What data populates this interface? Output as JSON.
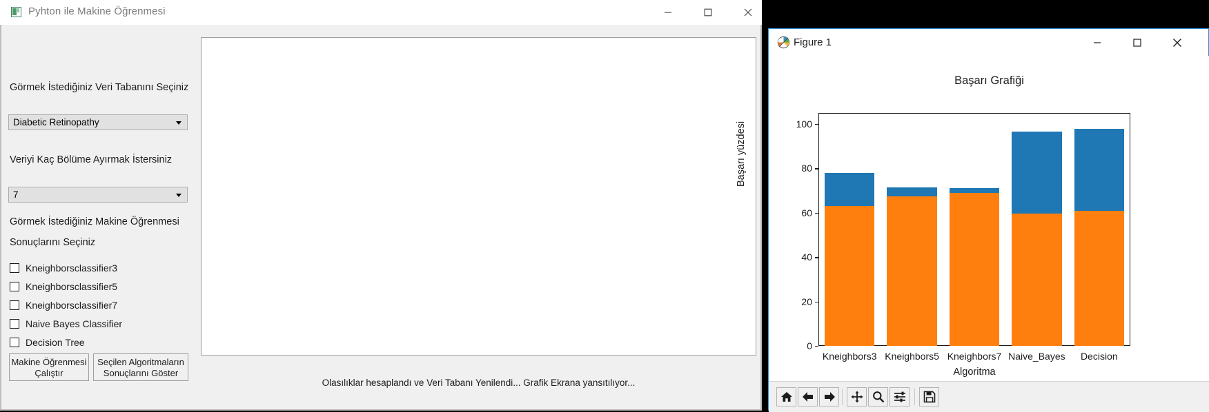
{
  "main_window": {
    "title": "Pyhton ile Makine Öğrenmesi",
    "icon": "app-icon",
    "controls": {
      "minimize": "minimize-icon",
      "maximize": "maximize-icon",
      "close": "close-icon"
    },
    "labels": {
      "database": "Görmek İstediğiniz Veri Tabanını Seçiniz",
      "split": "Veriyi Kaç Bölüme Ayırmak İstersiniz",
      "algorithms_line1": "Görmek İstediğiniz Makine Öğrenmesi",
      "algorithms_line2": "Sonuçlarını Seçiniz"
    },
    "database_select": {
      "value": "Diabetic Retinopathy",
      "arrow": "chevron-down-icon"
    },
    "split_select": {
      "value": "7",
      "arrow": "chevron-down-icon"
    },
    "checkboxes": [
      {
        "label": "Kneighborsclassifier3",
        "checked": false
      },
      {
        "label": "Kneighborsclassifier5",
        "checked": false
      },
      {
        "label": "Kneighborsclassifier7",
        "checked": false
      },
      {
        "label": "Naive Bayes Classifier",
        "checked": false
      },
      {
        "label": "Decision Tree",
        "checked": false
      }
    ],
    "buttons": {
      "run_line1": "Makine Öğrenmesi",
      "run_line2": "Çalıştır",
      "show_line1": "Seçilen Algoritmaların",
      "show_line2": "Sonuçlarını Göster"
    },
    "status": "Olasılıklar hesaplandı ve Veri Tabanı Yenilendi... Grafik Ekrana yansıtılıyor..."
  },
  "figure_window": {
    "title": "Figure 1",
    "icon": "matplotlib-icon",
    "controls": {
      "minimize": "minimize-icon",
      "maximize": "maximize-icon",
      "close": "close-icon"
    },
    "toolbar": [
      {
        "name": "home-icon",
        "tooltip": "Home"
      },
      {
        "name": "back-arrow-icon",
        "tooltip": "Back"
      },
      {
        "name": "forward-arrow-icon",
        "tooltip": "Forward"
      },
      {
        "name": "pan-move-icon",
        "tooltip": "Pan"
      },
      {
        "name": "zoom-magnifier-icon",
        "tooltip": "Zoom"
      },
      {
        "name": "configure-sliders-icon",
        "tooltip": "Configure subplots"
      },
      {
        "name": "save-floppy-icon",
        "tooltip": "Save"
      }
    ]
  },
  "chart_data": {
    "type": "bar",
    "stacked": true,
    "title": "Başarı Grafiği",
    "xlabel": "Algoritma",
    "ylabel": "Başarı yüzdesi",
    "categories": [
      "Kneighbors3",
      "Kneighbors5",
      "Kneighbors7",
      "Naive_Bayes",
      "Decision"
    ],
    "yticks": [
      0,
      20,
      40,
      60,
      80,
      100
    ],
    "ylim": [
      0,
      105
    ],
    "grid": false,
    "legend": "none",
    "series": [
      {
        "name": "orange-series",
        "color": "#ff7f0e",
        "values": [
          63,
          67.5,
          69,
          59.5,
          61
        ]
      },
      {
        "name": "blue-series",
        "color": "#1f77b4",
        "values": [
          15,
          4,
          2,
          37,
          37
        ]
      }
    ],
    "totals": [
      78,
      71.5,
      71,
      96.5,
      98
    ]
  }
}
